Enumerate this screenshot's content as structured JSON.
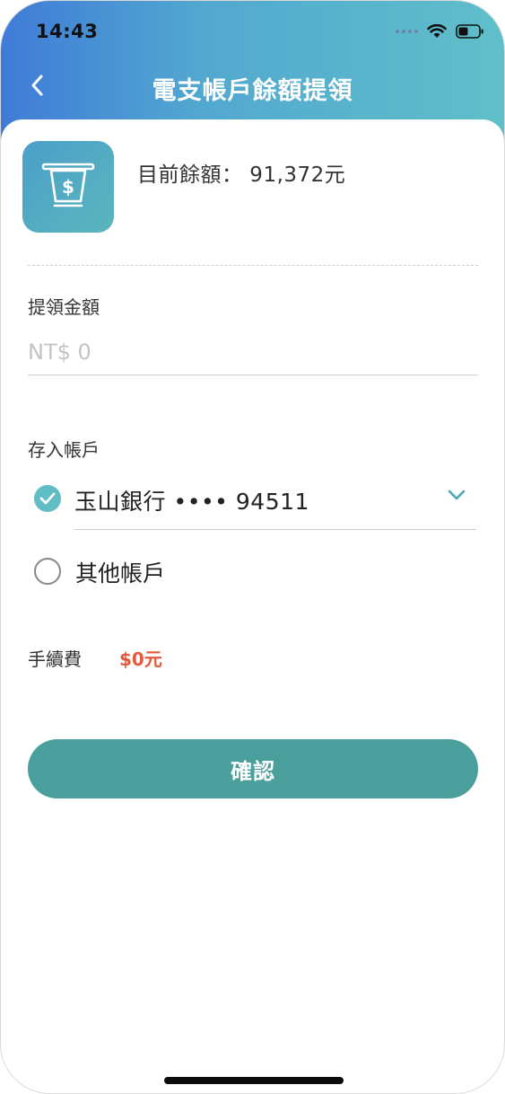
{
  "status_bar": {
    "time": "14:43",
    "icons": [
      "signal-dots-icon",
      "wifi-icon",
      "battery-icon"
    ]
  },
  "nav": {
    "title": "電支帳戶餘額提領",
    "back_icon": "chevron-left-icon"
  },
  "balance": {
    "icon": "atm-withdraw-icon",
    "text": "目前餘額： 91,372元"
  },
  "amount": {
    "label": "提領金額",
    "placeholder": "NT$ 0",
    "value": ""
  },
  "deposit": {
    "label": "存入帳戶",
    "selected_bank": "玉山銀行 •••• 94511",
    "other_label": "其他帳戶"
  },
  "fee": {
    "label": "手續費",
    "value": "$0元"
  },
  "confirm_label": "確認",
  "colors": {
    "header_start": "#3f7bd8",
    "header_end": "#5fbfc9",
    "accent": "#5fbdc3",
    "button": "#4a9e9b",
    "fee": "#e2593b"
  }
}
